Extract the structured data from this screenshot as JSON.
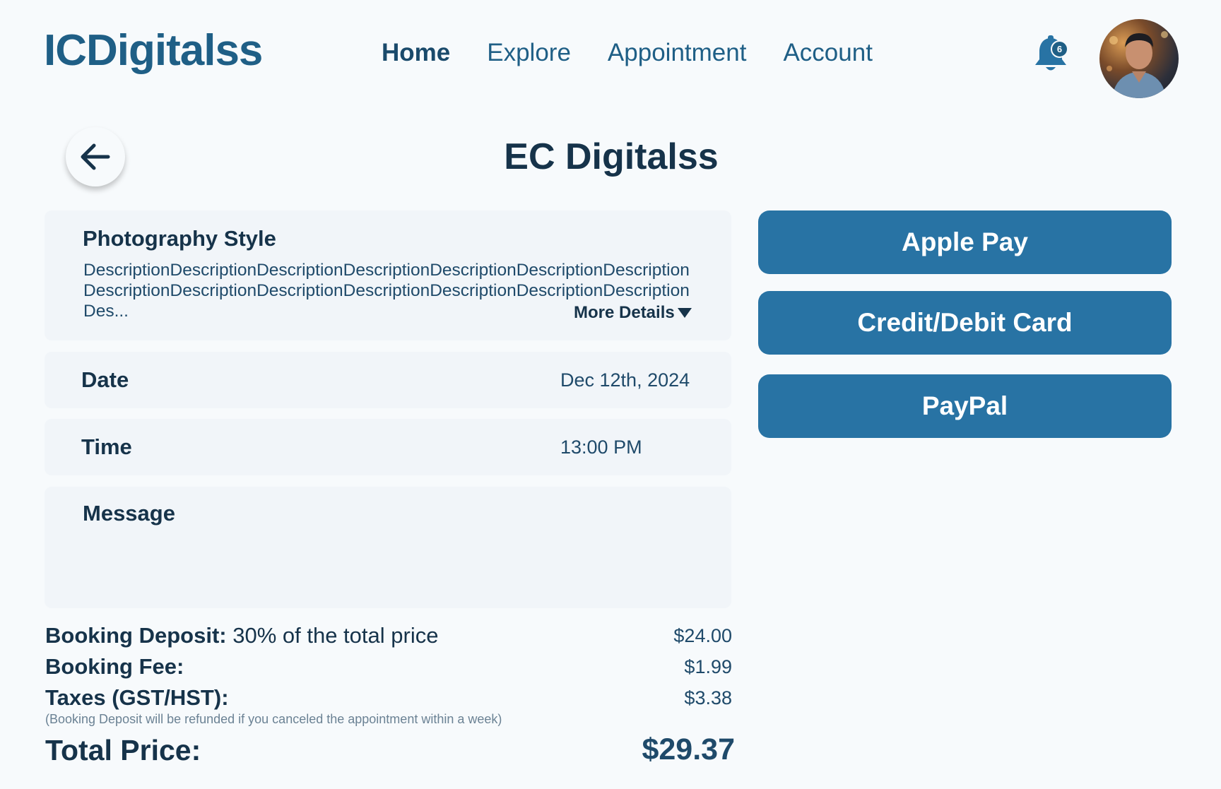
{
  "app": {
    "logo": "ICDigitalss"
  },
  "nav": {
    "items": [
      {
        "label": "Home",
        "active": true
      },
      {
        "label": "Explore",
        "active": false
      },
      {
        "label": "Appointment",
        "active": false
      },
      {
        "label": "Account",
        "active": false
      }
    ]
  },
  "header": {
    "notification_count": "6",
    "bell_icon": "bell-icon",
    "avatar_icon": "user-avatar"
  },
  "page": {
    "title": "EC Digitalss",
    "back_icon": "arrow-left-icon"
  },
  "details": {
    "style_heading": "Photography Style",
    "description": "DescriptionDescriptionDescriptionDescriptionDescriptionDescriptionDescriptionDescriptionDescriptionDescriptionDescriptionDescriptionDescriptionDescriptionDes...",
    "more_details": "More Details",
    "date_label": "Date",
    "date_value": "Dec 12th, 2024",
    "time_label": "Time",
    "time_value": "13:00 PM",
    "message_label": "Message"
  },
  "pricing": {
    "deposit_label": "Booking Deposit:",
    "deposit_desc": " 30% of the total price",
    "deposit_value": "$24.00",
    "fee_label": "Booking Fee:",
    "fee_value": "$1.99",
    "tax_label": "Taxes (GST/HST):",
    "tax_value": "$3.38",
    "note": "(Booking Deposit will be refunded if you canceled the appointment within a week)",
    "total_label": "Total Price:",
    "total_value": "$29.37"
  },
  "payment": {
    "apple_pay": "Apple Pay",
    "card": "Credit/Debit Card",
    "paypal": "PayPal"
  },
  "colors": {
    "primary": "#2873a4",
    "logo": "#1f5f86",
    "text_dark": "#16334a",
    "background": "#f7fafc",
    "card": "#f1f5f9"
  }
}
